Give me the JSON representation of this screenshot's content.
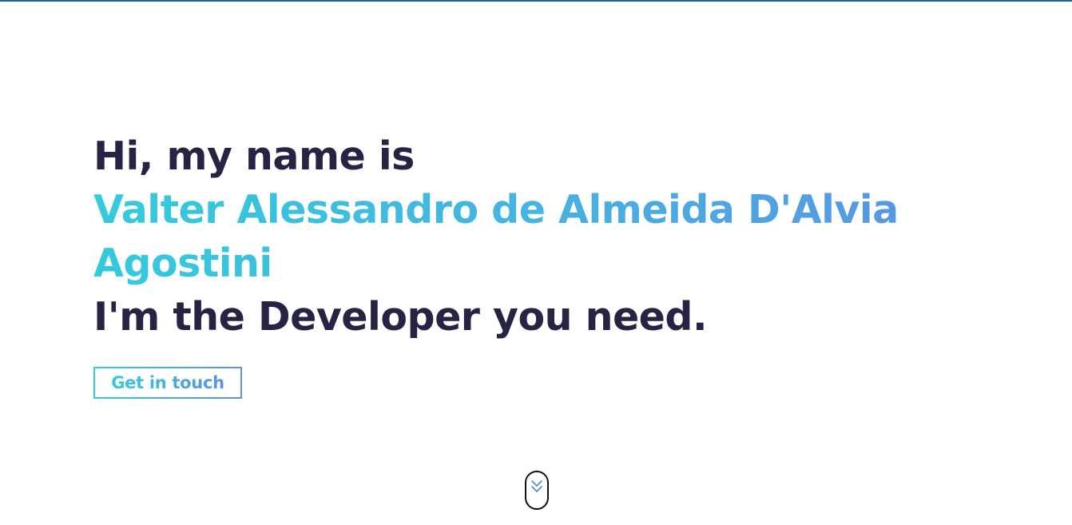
{
  "hero": {
    "greeting": "Hi, my name is",
    "name_line_1": "Valter Alessandro de Almeida D'Alvia",
    "name_line_2": "Agostini",
    "tagline": "I'm the Developer you need."
  },
  "cta": {
    "label": "Get in touch"
  },
  "scroll": {
    "icon": "double-chevron-down-icon"
  },
  "colors": {
    "text_dark": "#262443",
    "gradient_start": "#34cbdb",
    "gradient_end": "#5a91e4",
    "top_bar": "#1f5f93"
  }
}
